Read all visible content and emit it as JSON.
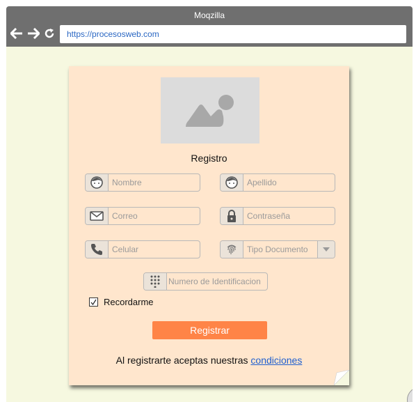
{
  "browser": {
    "title": "Moqzilla",
    "url": "https://procesosweb.com"
  },
  "form": {
    "heading": "Registro",
    "fields": {
      "nombre": "Nombre",
      "apellido": "Apellido",
      "correo": "Correo",
      "contrasena": "Contraseña",
      "celular": "Celular",
      "tipo_documento": "Tipo Documento",
      "numero_identificacion": "Numero de Identificacion"
    },
    "remember_label": "Recordarme",
    "remember_checked": true,
    "submit_label": "Registrar",
    "terms_text": "Al registrarte aceptas nuestras",
    "terms_link": "condiciones"
  },
  "colors": {
    "titlebar": "#6f6f6f",
    "page_bg": "#f6f8e0",
    "card_bg": "#ffe6cd",
    "button": "#ff8447",
    "link": "#1f5fce"
  },
  "icons": [
    "back-arrow-icon",
    "forward-arrow-icon",
    "reload-icon",
    "image-placeholder-icon",
    "face-icon",
    "envelope-icon",
    "lock-icon",
    "phone-icon",
    "fingerprint-icon",
    "chevron-down-icon",
    "keypad-icon",
    "checkmark-icon",
    "user-avatar-icon"
  ]
}
